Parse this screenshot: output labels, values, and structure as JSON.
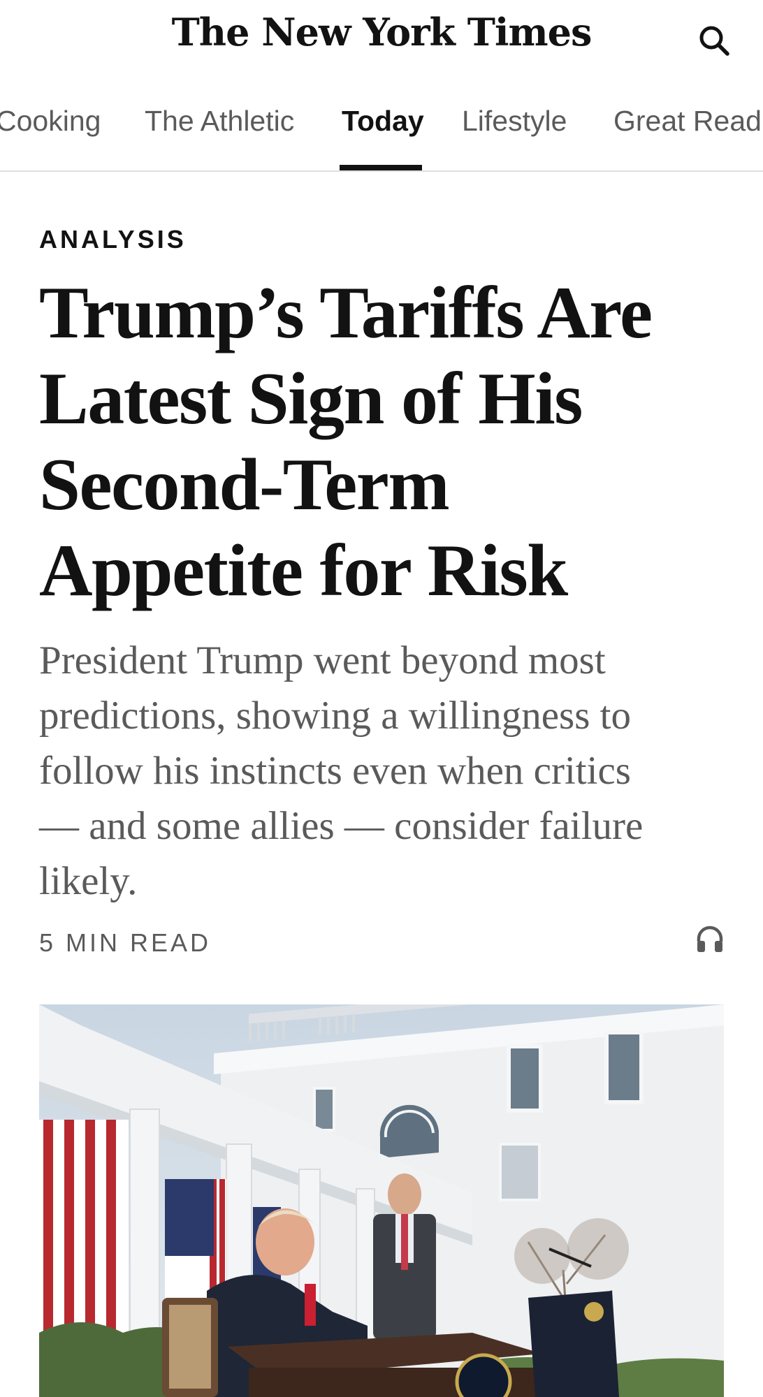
{
  "masthead": {
    "logo_text": "The New York Times",
    "search_icon": "search-icon"
  },
  "tabs": [
    {
      "label": "Cooking",
      "active": false
    },
    {
      "label": "The Athletic",
      "active": false
    },
    {
      "label": "Today",
      "active": true
    },
    {
      "label": "Lifestyle",
      "active": false
    },
    {
      "label": "Great Read",
      "active": false
    }
  ],
  "article": {
    "kicker": "ANALYSIS",
    "headline_lines": [
      "Trump’s Tariffs Are",
      "Latest Sign of His",
      "Second-Term",
      "Appetite for Risk"
    ],
    "summary_lines": [
      "President Trump went beyond most",
      "predictions, showing a willingness to",
      "follow his instincts even when critics",
      "— and some allies — consider failure",
      "likely."
    ],
    "read_time": "5 MIN READ",
    "listen_icon": "headphones-icon"
  },
  "lead_image": {
    "subject": "photo"
  }
}
